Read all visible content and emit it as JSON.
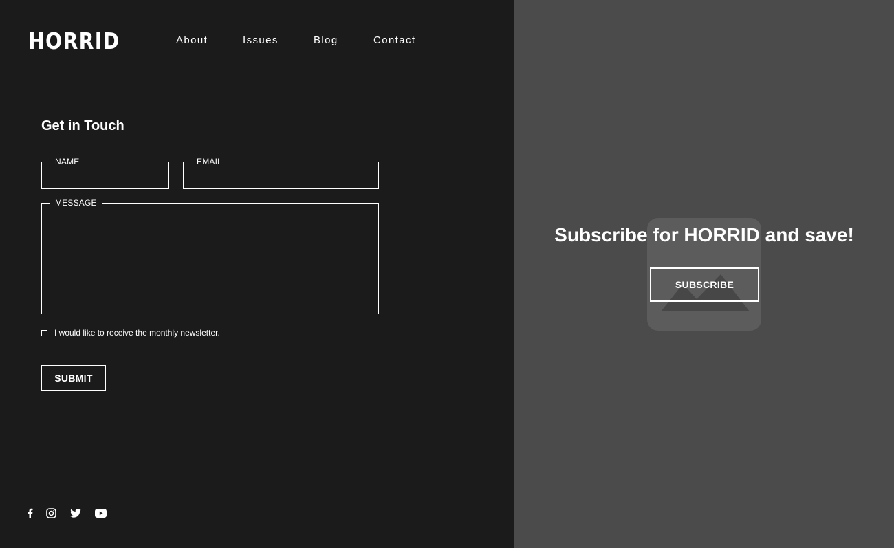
{
  "brand": {
    "logo": "HORRID"
  },
  "nav": {
    "about": "About",
    "issues": "Issues",
    "blog": "Blog",
    "contact": "Contact"
  },
  "contact_form": {
    "title": "Get in Touch",
    "name_label": "NAME",
    "name_value": "",
    "email_label": "EMAIL",
    "email_value": "",
    "message_label": "MESSAGE",
    "message_value": "",
    "newsletter_label": "I would like to receive the monthly newsletter.",
    "newsletter_checked": false,
    "submit_label": "SUBMIT"
  },
  "social": [
    "facebook-icon",
    "instagram-icon",
    "twitter-icon",
    "youtube-icon"
  ],
  "promo": {
    "headline": "Subscribe for HORRID and save!",
    "subscribe_label": "SUBSCRIBE"
  },
  "colors": {
    "left_background": "#1b1b1b",
    "right_background": "#4b4b4b",
    "image_placeholder": "#5c5c5c",
    "text": "#ffffff"
  }
}
